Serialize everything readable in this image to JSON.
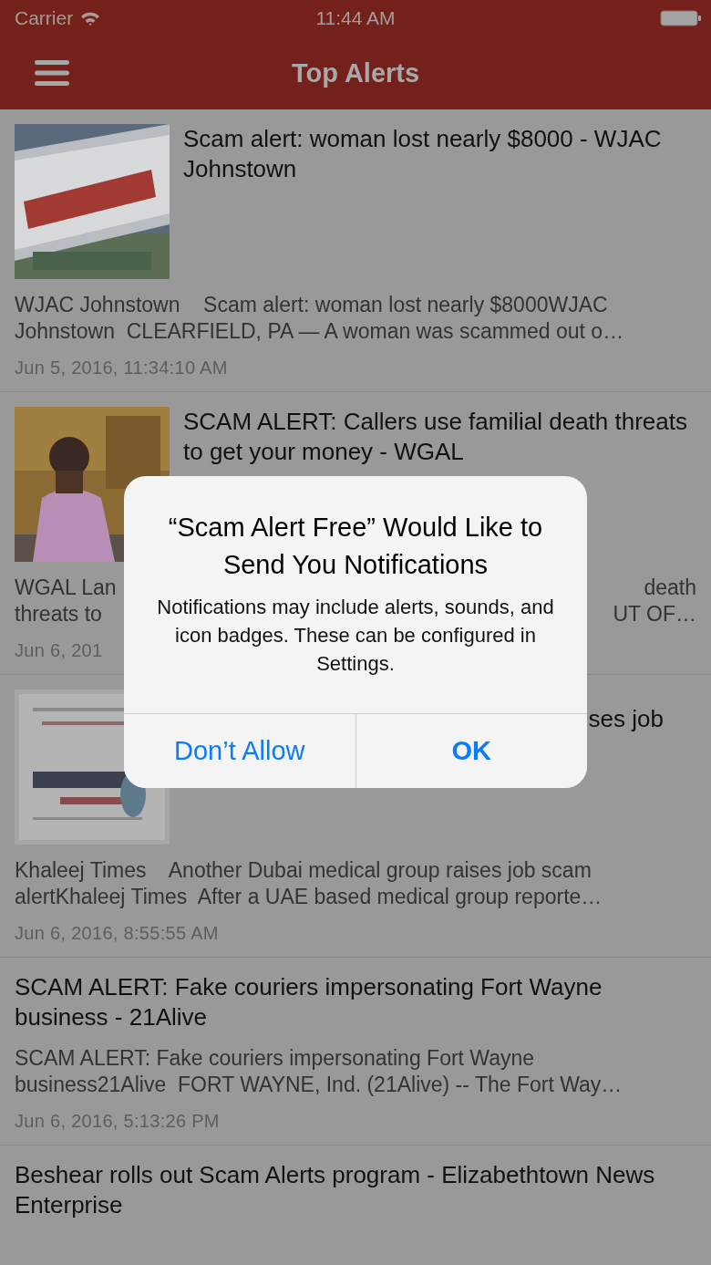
{
  "status_bar": {
    "carrier": "Carrier",
    "time": "11:44 AM"
  },
  "nav": {
    "title": "Top Alerts"
  },
  "articles": [
    {
      "thumbnail": {
        "kind": "picture"
      },
      "headline": "Scam alert: woman lost nearly $8000 - WJAC Johnstown",
      "summary_lines": [
        [
          "WJAC Johnstown    Scam alert: woman lost nearly $8000WJAC"
        ],
        [
          "Johnstown  CLEARFIELD, PA — A woman was scammed out o…"
        ]
      ],
      "date": "Jun 5, 2016, 11:34:10 AM"
    },
    {
      "thumbnail": {
        "kind": "picture"
      },
      "headline": "SCAM ALERT: Callers use familial death threats to get your money - WGAL",
      "summary_lines": [
        [
          "WGAL Lan",
          "death"
        ],
        [
          "threats to",
          "UT OF…"
        ]
      ],
      "date": "Jun 6, 201"
    },
    {
      "thumbnail": {
        "kind": "picture"
      },
      "headline_visible_part": "ses job",
      "summary_lines": [
        [
          "Khaleej Times    Another Dubai medical group raises job scam"
        ],
        [
          "alertKhaleej Times  After a UAE based medical group reporte…"
        ]
      ],
      "date": "Jun 6, 2016, 8:55:55 AM"
    },
    {
      "headline": "SCAM ALERT: Fake couriers impersonating Fort Wayne business - 21Alive",
      "summary_lines": [
        [
          "SCAM ALERT: Fake couriers impersonating Fort Wayne"
        ],
        [
          "business21Alive  FORT WAYNE, Ind. (21Alive) -- The Fort Way…"
        ]
      ],
      "date": "Jun 6, 2016, 5:13:26 PM"
    },
    {
      "headline": "Beshear rolls out Scam Alerts program - Elizabethtown News Enterprise"
    }
  ],
  "dialog": {
    "title": "“Scam Alert Free” Would Like to Send You Notifications",
    "message": "Notifications may include alerts, sounds, and icon badges. These can be configured in Settings.",
    "buttons": [
      {
        "label": "Don’t Allow",
        "kind": "normal"
      },
      {
        "label": "OK",
        "kind": "default"
      }
    ]
  }
}
